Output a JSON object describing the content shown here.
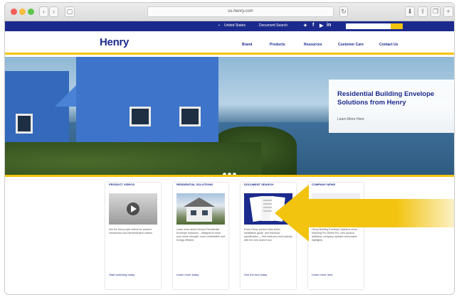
{
  "browser": {
    "url": "us.henry.com"
  },
  "topbar": {
    "links": [
      "United States",
      "Document Search"
    ],
    "social": [
      "f",
      "in"
    ],
    "go_label": "Go"
  },
  "header": {
    "logo": "Henry",
    "nav": [
      "Brand",
      "Products",
      "Resources",
      "Customer Care",
      "Contact Us"
    ]
  },
  "hero": {
    "promo_title": "Residential Building Envelope Solutions from Henry",
    "promo_link": "Learn More Here"
  },
  "cards": [
    {
      "title": "PRODUCT VIDEOS",
      "text": "Get the Henry Injet videos for product introduction and demonstration videos.",
      "link": "Start watching today"
    },
    {
      "title": "RESIDENTIAL SOLUTIONS",
      "text": "Learn more about Henry's Residential Envelope Solutions – designed to keep your home stronger, more comfortable and energy efficient.",
      "link": "Learn more today"
    },
    {
      "title": "DOCUMENT SEARCH",
      "text": "Every Henry product data sheet, installation guide, and technical specification — find what you need quickly with the new search tool.",
      "link": "See the tool today"
    },
    {
      "title": "COMPANY NEWS",
      "text": "Henry Building Envelope Systems news, featuring Pro-Shield Pro, new product additions, company updates and project highlights.",
      "link": "Learn more here"
    }
  ],
  "colors": {
    "brand_blue": "#1b2a8c",
    "accent_yellow": "#f2c30f"
  }
}
